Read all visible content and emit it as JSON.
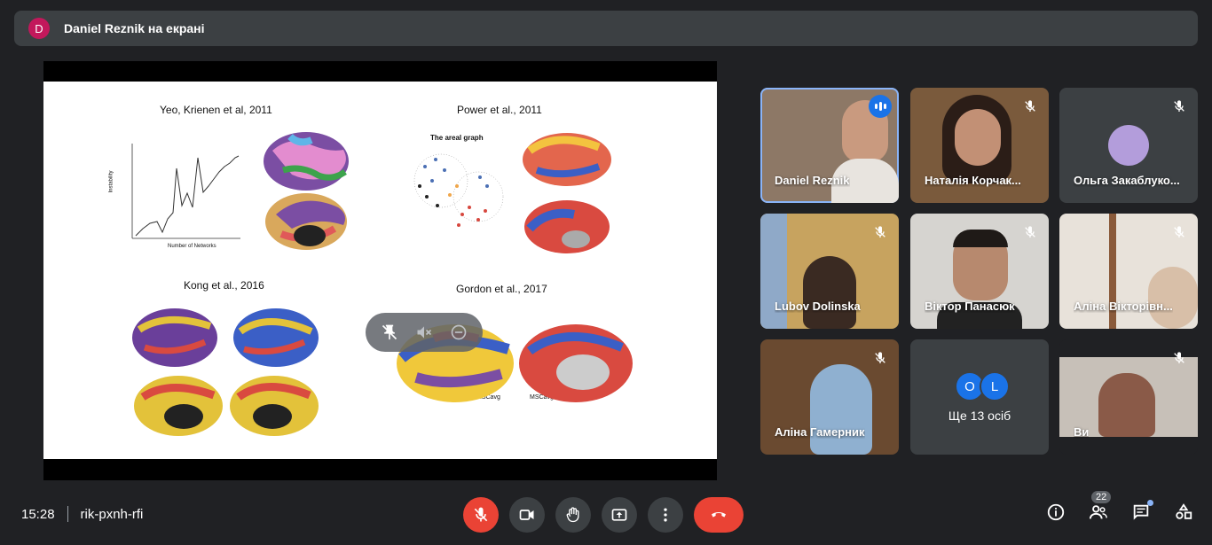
{
  "banner": {
    "avatar_letter": "D",
    "text": "Daniel Reznik на екрані"
  },
  "slide": {
    "titles": [
      "Yeo, Krienen et al, 2011",
      "Power et al., 2011",
      "Kong et al., 2016",
      "Gordon et al., 2017"
    ],
    "areal_graph_label": "The areal graph",
    "x_axis_label": "Number of Networks",
    "y_axis_label": "Instability",
    "mscavg_label": "MSCavg"
  },
  "participants": [
    {
      "name": "Daniel Reznik",
      "speaking": true
    },
    {
      "name": "Наталія Корчак...",
      "muted": true
    },
    {
      "name": "Ольга Закаблуко...",
      "muted": true
    },
    {
      "name": "Lubov Dolinska",
      "muted": true
    },
    {
      "name": "Віктор Панасюк",
      "muted": true
    },
    {
      "name": "Аліна Вікторівн...",
      "muted": true
    },
    {
      "name": "Аліна Гамерник",
      "muted": true
    },
    {
      "name": "Ви",
      "muted": true
    }
  ],
  "more": {
    "avatars": [
      "O",
      "L"
    ],
    "label": "Ще 13 осіб"
  },
  "meeting": {
    "time": "15:28",
    "code": "rik-pxnh-rfi"
  },
  "participant_count": "22",
  "colors": {
    "end_call": "#ea4335",
    "speaking": "#1a73e8",
    "active_border": "#8ab4f8"
  }
}
